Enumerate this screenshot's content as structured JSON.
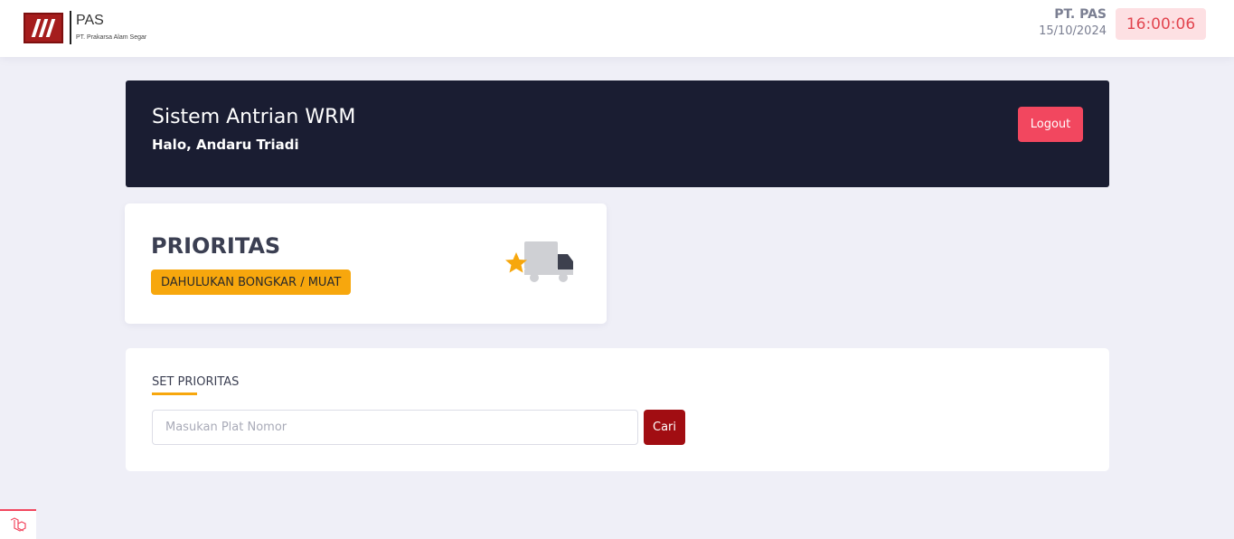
{
  "topbar": {
    "brand_name": "PAS",
    "brand_sub": "PT. Prakarsa Alam Segar",
    "company": "PT. PAS",
    "date": "15/10/2024",
    "clock": "16:00:06"
  },
  "hero": {
    "title": "Sistem Antrian WRM",
    "greeting": "Halo, Andaru Triadi",
    "logout_label": "Logout"
  },
  "priority": {
    "title": "PRIORITAS",
    "badge": "DAHULUKAN BONGKAR / MUAT",
    "icon": "truck-star-icon"
  },
  "set_priority": {
    "title": "SET PRIORITAS",
    "input_placeholder": "Masukan Plat Nomor",
    "input_value": "",
    "search_label": "Cari"
  },
  "colors": {
    "accent": "#f7a70d",
    "danger": "#f2475f",
    "primary_dark": "#1a1d32",
    "search_button": "#a10d12"
  }
}
